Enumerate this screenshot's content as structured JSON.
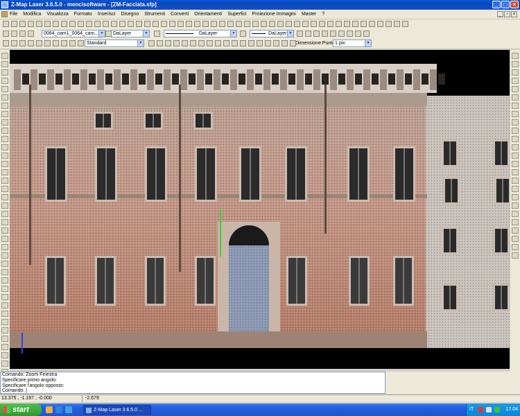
{
  "window": {
    "title": "Z-Map Laser 3.6.5.0 - mencisoftware - [ZM-Facciata.sfp]",
    "controls": [
      "minimize-button",
      "maximize-button",
      "close-button"
    ]
  },
  "menu": {
    "items": [
      "File",
      "Modifica",
      "Visualizza",
      "Formato",
      "Inserisci",
      "Disegno",
      "Strumenti",
      "Converti",
      "Orientamenti",
      "Superfici",
      "Proiezione Immagini",
      "Master",
      "?"
    ]
  },
  "toolbar2": {
    "layer_combo": "0064_cam1_0064_cam...",
    "color_combo": "DaLayer",
    "linetype_combo": "DaLayer",
    "lineweight_combo": "DaLayer"
  },
  "toolbar3": {
    "textstyle_combo": "Standard",
    "point_size_label": "Dimensione Punto:",
    "point_size_value": "1 pix"
  },
  "command": {
    "lines": [
      "Comando:   Zoom Finestra",
      "Specificare primo angolo:",
      "Specificare l'angolo opposto:",
      "Comando:  |"
    ]
  },
  "status": {
    "coords": "13.375 , -1.197 , -0.000",
    "value": "-2.679"
  },
  "taskbar": {
    "start_label": "start",
    "task_label": "Z-Map Laser 3.6.5.0 ...",
    "language": "IT",
    "clock": "17.04"
  },
  "colors": {
    "title_blue": "#0a58d8",
    "canvas_bg": "#000000",
    "start_green": "#2e9a2e"
  },
  "icons": {
    "left_toolbar": [
      "line-icon",
      "polyline-icon",
      "arc-icon",
      "circle-icon",
      "rectangle-icon",
      "text-icon",
      "hatch-icon",
      "move-icon",
      "rotate-icon",
      "scale-icon"
    ],
    "right_toolbar": [
      "surface-icon",
      "mesh-icon",
      "texture-icon",
      "section-icon",
      "layer-icon"
    ]
  }
}
